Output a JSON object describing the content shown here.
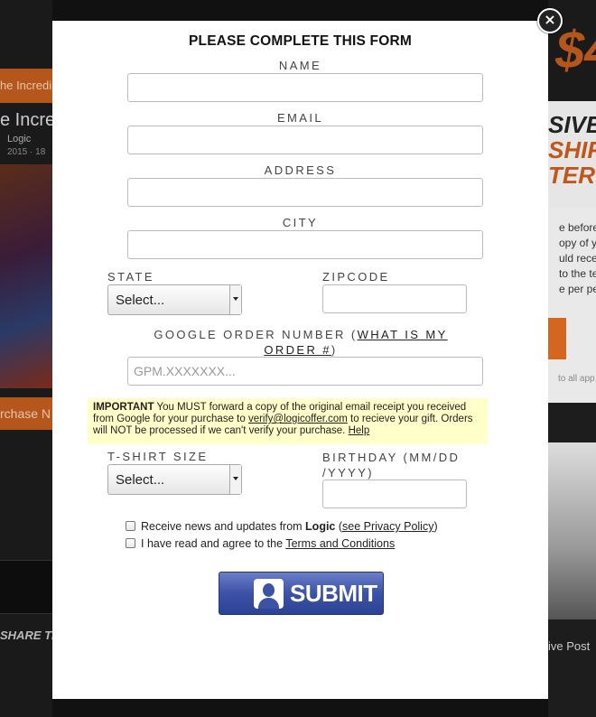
{
  "background": {
    "album_strip": "he Incredi",
    "album_title": "e Incre",
    "artist": "Logic",
    "date": "2015 · 18",
    "purchase": "rchase N",
    "share": "SHARE TH",
    "right_price": "$4",
    "right_promo": [
      "SIVE",
      "SHIR",
      "TER!"
    ],
    "right_text": [
      "e before",
      "opy of yo",
      "uld rece",
      "to the te",
      "e per pers"
    ],
    "right_small": "to all app",
    "right_caption": "ive Post"
  },
  "modal": {
    "close_symbol": "×",
    "title": "PLEASE COMPLETE THIS FORM",
    "fields": {
      "name_label": "NAME",
      "email_label": "EMAIL",
      "address_label": "ADDRESS",
      "city_label": "CITY",
      "state_label": "STATE",
      "state_value": "Select...",
      "zip_label": "ZIPCODE",
      "order_label": "GOOGLE ORDER NUMBER (",
      "order_link": "WHAT IS MY ORDER #",
      "order_label_end": ")",
      "order_placeholder": "GPM.XXXXXXX...",
      "tshirt_label": "T-SHIRT SIZE",
      "tshirt_value": "Select...",
      "birthday_label": "BIRTHDAY (MM/DD /YYYY)"
    },
    "important": {
      "strong": "IMPORTANT",
      "text1": " You MUST forward a copy of the original email receipt you received from Google for your purchase to ",
      "email_link": "verify@logicoffer.com",
      "text2": " to recieve your gift. Orders will NOT be processed if we can't verify your purchase. ",
      "help_link": "Help"
    },
    "checkboxes": {
      "news_text": "Receive news and updates from ",
      "news_brand": "Logic",
      "news_open": " (",
      "privacy_link": "see Privacy Policy",
      "news_close": ")",
      "terms_text": "I have read and agree to the ",
      "terms_link": "Terms and Conditions"
    },
    "submit_label": "SUBMIT"
  },
  "colors": {
    "submit_blue": "#3b52a6",
    "important_bg": "#ffffc9",
    "accent_orange": "#b5561c"
  }
}
